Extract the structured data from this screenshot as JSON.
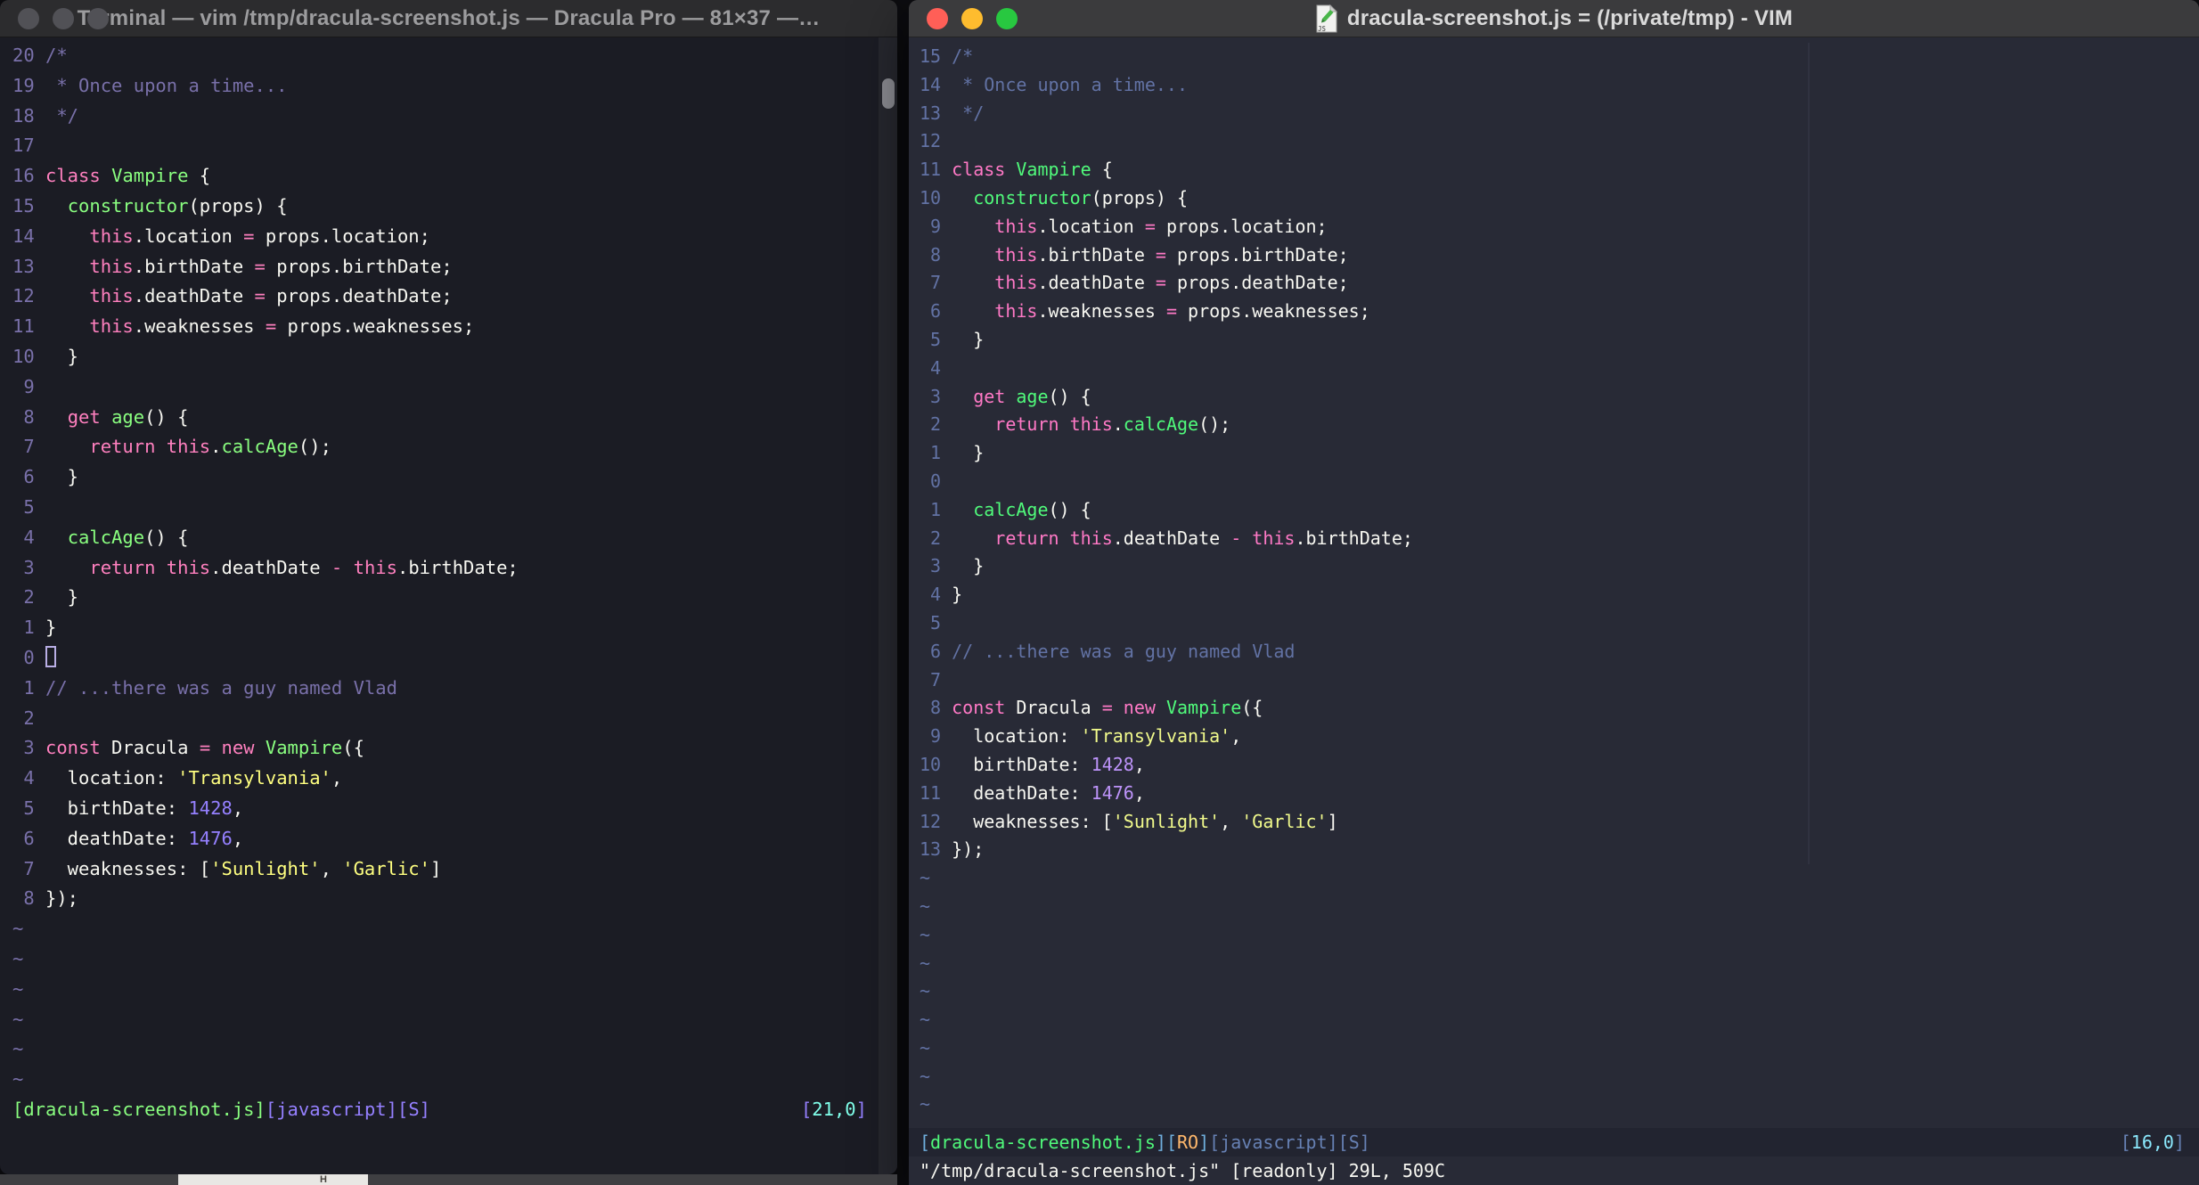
{
  "chrome": {
    "screen_bg": "#0D0D11",
    "left_titlebar_bg": "#2C2C2E",
    "right_titlebar_bg": "#3B3B3D",
    "left_title_color": "#9C9C9E",
    "right_title_color": "#DADADA",
    "light_inactive": "#515156",
    "light_red": "#FF5F57",
    "light_yellow": "#FEBC2E",
    "light_green": "#28C840",
    "sliver_bg": "#3F3F42",
    "sliver_white": "#E9E7E4",
    "sliver_text_color": "#44403B"
  },
  "palette": {
    "left": {
      "bg": "#1B1C24",
      "fg": "#F8F8F2",
      "comment": "#7970A9",
      "keyword": "#FF80BF",
      "func": "#8AFF80",
      "string": "#FFFF80",
      "number": "#9580FF",
      "linenr": "#7970A9",
      "tilde": "#7970A9",
      "cursor": "#B9AEE5",
      "green": "#8AFF80",
      "purple": "#9580FF",
      "cyan": "#80FFEA",
      "track": "#26272E",
      "thumb": "#8A8B91"
    },
    "right": {
      "bg": "#282A36",
      "fg": "#F8F8F2",
      "comment": "#6272A4",
      "keyword": "#FF79C6",
      "func": "#50FA7B",
      "string": "#F1FA8C",
      "number": "#BD93F9",
      "linenr": "#6272A4",
      "tilde": "#6272A4",
      "green": "#50FA7B",
      "orange": "#FFB86C",
      "blue": "#6FAEDC",
      "lnblue": "#6781B4",
      "cyan": "#8BE9FD",
      "statusbg": "#222430",
      "colorcolumn": "#303240"
    }
  },
  "left_window": {
    "title": "Terminal — vim /tmp/dracula-screenshot.js — Dracula Pro — 81×37 —…",
    "rel_numbers": [
      20,
      19,
      18,
      17,
      16,
      15,
      14,
      13,
      12,
      11,
      10,
      9,
      8,
      7,
      6,
      5,
      4,
      3,
      2,
      1,
      0,
      1,
      2,
      3,
      4,
      5,
      6,
      7,
      8
    ],
    "cursor_line": 20,
    "cursor": "hollow",
    "tildes": 6,
    "status_left": [
      [
        "green",
        "[dracula-screenshot.js]"
      ],
      [
        "purple",
        "[javascript][S]"
      ]
    ],
    "status_right": [
      [
        "purple",
        "["
      ],
      [
        "cyan",
        "21,0"
      ],
      [
        "purple",
        "]"
      ]
    ]
  },
  "right_window": {
    "title": "dracula-screenshot.js = (/private/tmp) - VIM",
    "proxy_icon": "js-file-icon",
    "rel_numbers": [
      15,
      14,
      13,
      12,
      11,
      10,
      9,
      8,
      7,
      6,
      5,
      4,
      3,
      2,
      1,
      0,
      1,
      2,
      3,
      4,
      5,
      6,
      7,
      8,
      9,
      10,
      11,
      12,
      13
    ],
    "cursor_line": 15,
    "cursor": "none",
    "tildes": 9,
    "status_left": [
      [
        "blue",
        "["
      ],
      [
        "green",
        "dracula-screenshot.js"
      ],
      [
        "blue",
        "]["
      ],
      [
        "orange",
        "RO"
      ],
      [
        "blue",
        "]"
      ],
      [
        "lnblue",
        "[javascript][S]"
      ]
    ],
    "status_right": [
      [
        "lnblue",
        "["
      ],
      [
        "cyan",
        "16,0"
      ],
      [
        "lnblue",
        "]"
      ]
    ],
    "message": "\"/tmp/dracula-screenshot.js\" [readonly] 29L, 509C"
  },
  "background": {
    "peek_text": "H"
  },
  "code": {
    "lines": [
      {
        "tokens": [
          [
            "c",
            "/*"
          ]
        ]
      },
      {
        "tokens": [
          [
            "c",
            " * Once upon a time..."
          ]
        ]
      },
      {
        "tokens": [
          [
            "c",
            " */"
          ]
        ]
      },
      {
        "tokens": []
      },
      {
        "tokens": [
          [
            "k",
            "class"
          ],
          [
            "d",
            " "
          ],
          [
            "f",
            "Vampire"
          ],
          [
            "d",
            " {"
          ]
        ]
      },
      {
        "tokens": [
          [
            "d",
            "  "
          ],
          [
            "f",
            "constructor"
          ],
          [
            "d",
            "(props) {"
          ]
        ]
      },
      {
        "tokens": [
          [
            "d",
            "    "
          ],
          [
            "k",
            "this"
          ],
          [
            "d",
            ".location "
          ],
          [
            "k",
            "="
          ],
          [
            "d",
            " props.location;"
          ]
        ]
      },
      {
        "tokens": [
          [
            "d",
            "    "
          ],
          [
            "k",
            "this"
          ],
          [
            "d",
            ".birthDate "
          ],
          [
            "k",
            "="
          ],
          [
            "d",
            " props.birthDate;"
          ]
        ]
      },
      {
        "tokens": [
          [
            "d",
            "    "
          ],
          [
            "k",
            "this"
          ],
          [
            "d",
            ".deathDate "
          ],
          [
            "k",
            "="
          ],
          [
            "d",
            " props.deathDate;"
          ]
        ]
      },
      {
        "tokens": [
          [
            "d",
            "    "
          ],
          [
            "k",
            "this"
          ],
          [
            "d",
            ".weaknesses "
          ],
          [
            "k",
            "="
          ],
          [
            "d",
            " props.weaknesses;"
          ]
        ]
      },
      {
        "tokens": [
          [
            "d",
            "  }"
          ]
        ]
      },
      {
        "tokens": []
      },
      {
        "tokens": [
          [
            "d",
            "  "
          ],
          [
            "k",
            "get"
          ],
          [
            "d",
            " "
          ],
          [
            "f",
            "age"
          ],
          [
            "d",
            "() {"
          ]
        ]
      },
      {
        "tokens": [
          [
            "d",
            "    "
          ],
          [
            "k",
            "return"
          ],
          [
            "d",
            " "
          ],
          [
            "k",
            "this"
          ],
          [
            "d",
            "."
          ],
          [
            "f",
            "calcAge"
          ],
          [
            "d",
            "();"
          ]
        ]
      },
      {
        "tokens": [
          [
            "d",
            "  }"
          ]
        ]
      },
      {
        "tokens": []
      },
      {
        "tokens": [
          [
            "d",
            "  "
          ],
          [
            "f",
            "calcAge"
          ],
          [
            "d",
            "() {"
          ]
        ]
      },
      {
        "tokens": [
          [
            "d",
            "    "
          ],
          [
            "k",
            "return"
          ],
          [
            "d",
            " "
          ],
          [
            "k",
            "this"
          ],
          [
            "d",
            ".deathDate "
          ],
          [
            "k",
            "-"
          ],
          [
            "d",
            " "
          ],
          [
            "k",
            "this"
          ],
          [
            "d",
            ".birthDate;"
          ]
        ]
      },
      {
        "tokens": [
          [
            "d",
            "  }"
          ]
        ]
      },
      {
        "tokens": [
          [
            "d",
            "}"
          ]
        ]
      },
      {
        "tokens": []
      },
      {
        "tokens": [
          [
            "c",
            "// ...there was a guy named Vlad"
          ]
        ]
      },
      {
        "tokens": []
      },
      {
        "tokens": [
          [
            "k",
            "const"
          ],
          [
            "d",
            " Dracula "
          ],
          [
            "k",
            "="
          ],
          [
            "d",
            " "
          ],
          [
            "k",
            "new"
          ],
          [
            "d",
            " "
          ],
          [
            "f",
            "Vampire"
          ],
          [
            "d",
            "({"
          ]
        ]
      },
      {
        "tokens": [
          [
            "d",
            "  location: "
          ],
          [
            "s",
            "'Transylvania'"
          ],
          [
            "d",
            ","
          ]
        ]
      },
      {
        "tokens": [
          [
            "d",
            "  birthDate: "
          ],
          [
            "n",
            "1428"
          ],
          [
            "d",
            ","
          ]
        ]
      },
      {
        "tokens": [
          [
            "d",
            "  deathDate: "
          ],
          [
            "n",
            "1476"
          ],
          [
            "d",
            ","
          ]
        ]
      },
      {
        "tokens": [
          [
            "d",
            "  weaknesses: ["
          ],
          [
            "s",
            "'Sunlight'"
          ],
          [
            "d",
            ", "
          ],
          [
            "s",
            "'Garlic'"
          ],
          [
            "d",
            "]"
          ]
        ]
      },
      {
        "tokens": [
          [
            "d",
            "});"
          ]
        ]
      }
    ]
  }
}
